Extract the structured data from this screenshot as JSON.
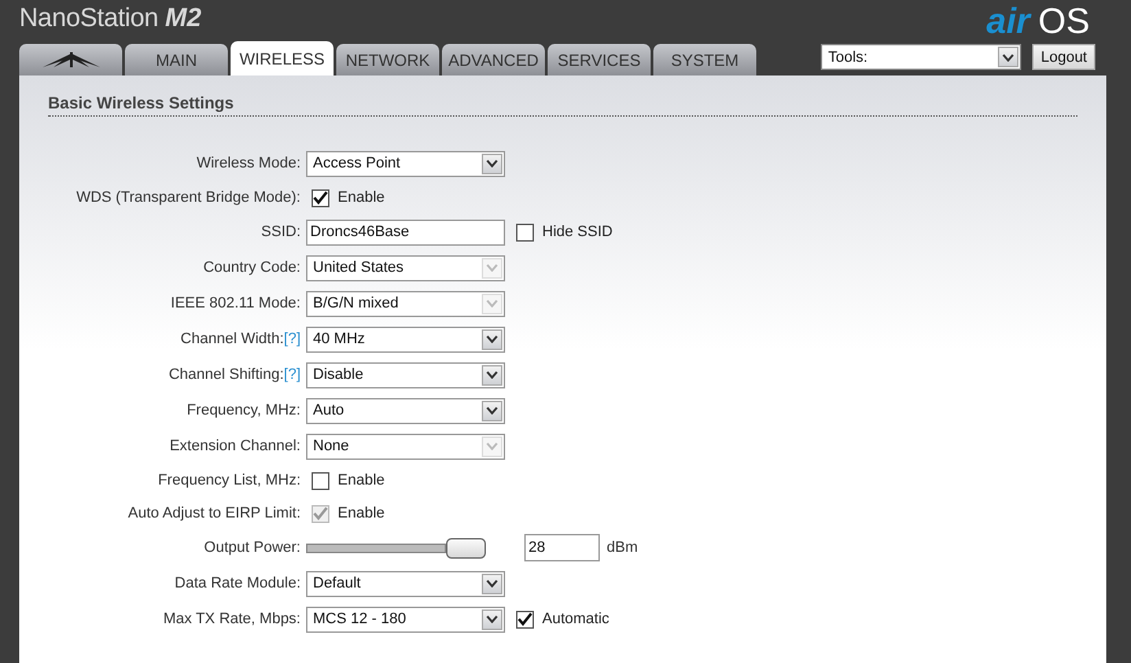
{
  "header": {
    "product": "NanoStation",
    "model": "M2",
    "logo_accent": "air",
    "logo_main": "OS"
  },
  "tabs": [
    {
      "kind": "icon",
      "selected": false
    },
    {
      "label": "MAIN",
      "selected": false
    },
    {
      "label": "WIRELESS",
      "selected": true
    },
    {
      "label": "NETWORK",
      "selected": false
    },
    {
      "label": "ADVANCED",
      "selected": false
    },
    {
      "label": "SERVICES",
      "selected": false
    },
    {
      "label": "SYSTEM",
      "selected": false
    }
  ],
  "tools": {
    "value": "Tools:"
  },
  "logout": "Logout",
  "section_title": "Basic Wireless Settings",
  "fields": [
    {
      "kind": "select",
      "label": "Wireless Mode:",
      "value": "Access Point",
      "disabled": false
    },
    {
      "kind": "checkbox",
      "label": "WDS (Transparent Bridge Mode):",
      "option": "Enable",
      "checked": true,
      "disabled": false
    },
    {
      "kind": "text",
      "label": "SSID:",
      "value": "Droncs46Base",
      "extra": {
        "option": "Hide SSID",
        "checked": false
      }
    },
    {
      "kind": "select",
      "label": "Country Code:",
      "value": "United States",
      "disabled": true
    },
    {
      "kind": "select",
      "label": "IEEE 802.11 Mode:",
      "value": "B/G/N mixed",
      "disabled": true
    },
    {
      "kind": "select",
      "label": "Channel Width:",
      "help": "[?]",
      "value": "40 MHz",
      "disabled": false
    },
    {
      "kind": "select",
      "label": "Channel Shifting:",
      "help": "[?]",
      "value": "Disable",
      "disabled": false
    },
    {
      "kind": "select",
      "label": "Frequency, MHz:",
      "value": "Auto",
      "disabled": false
    },
    {
      "kind": "select",
      "label": "Extension Channel:",
      "value": "None",
      "disabled": true
    },
    {
      "kind": "checkbox",
      "label": "Frequency List, MHz:",
      "option": "Enable",
      "checked": false,
      "disabled": false
    },
    {
      "kind": "checkbox",
      "label": "Auto Adjust to EIRP Limit:",
      "option": "Enable",
      "checked": true,
      "disabled": true
    },
    {
      "kind": "slider",
      "label": "Output Power:",
      "level": 1,
      "value": "28",
      "unit": "dBm"
    },
    {
      "kind": "select",
      "label": "Data Rate Module:",
      "value": "Default",
      "disabled": false
    },
    {
      "kind": "select",
      "label": "Max TX Rate, Mbps:",
      "value": "MCS 12 - 180",
      "disabled": false,
      "extra": {
        "option": "Automatic",
        "checked": true
      }
    }
  ]
}
